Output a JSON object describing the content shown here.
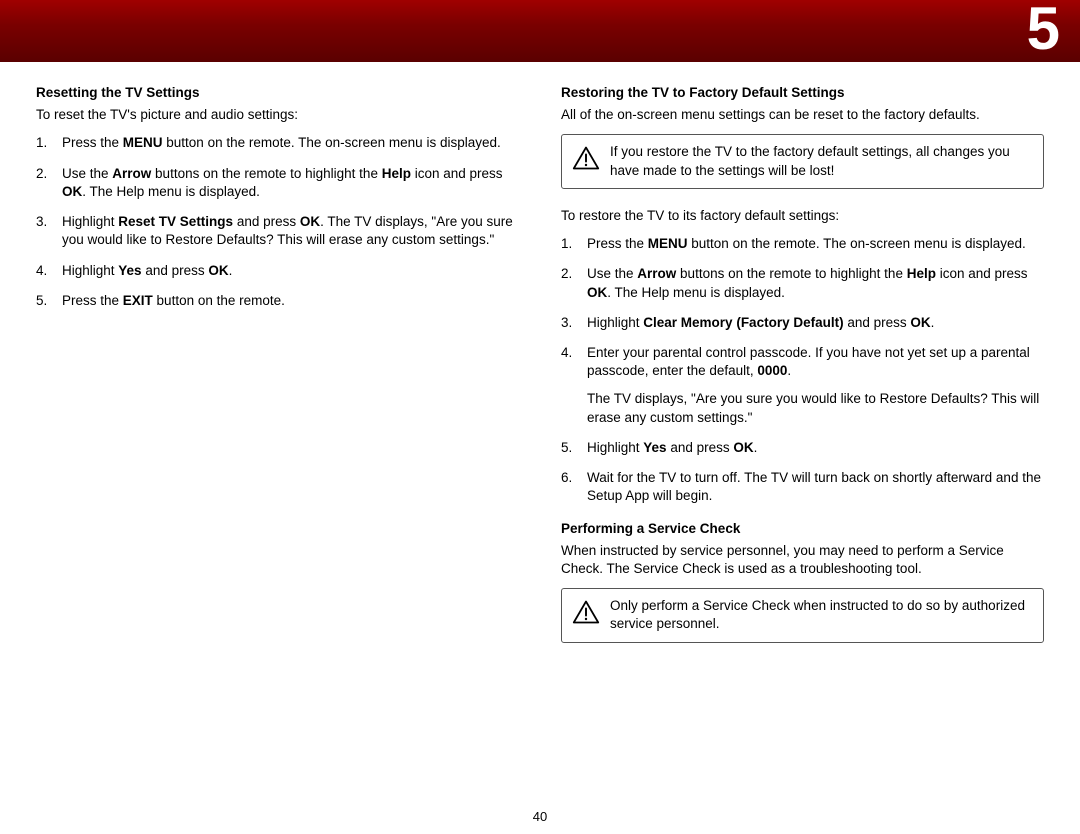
{
  "chapter": "5",
  "pageNumber": "40",
  "left": {
    "heading": "Resetting the TV Settings",
    "intro": "To reset the TV's picture and audio settings:",
    "steps": [
      {
        "pre": "Press the ",
        "b1": "MENU",
        "post1": " button on the remote. The on-screen menu is displayed."
      },
      {
        "pre": "Use the ",
        "b1": "Arrow",
        "mid1": " buttons on the remote to highlight the ",
        "b2": "Help",
        "mid2": " icon and press ",
        "b3": "OK",
        "post": ". The Help menu is displayed."
      },
      {
        "pre": "Highlight ",
        "b1": "Reset TV Settings",
        "mid1": " and press ",
        "b2": "OK",
        "post": ". The TV displays, \"Are you sure you would like to Restore Defaults? This will erase any custom settings.\""
      },
      {
        "pre": "Highlight ",
        "b1": "Yes",
        "mid1": " and press ",
        "b2": "OK",
        "post": "."
      },
      {
        "pre": "Press the ",
        "b1": "EXIT",
        "post1": " button on the remote."
      }
    ]
  },
  "right": {
    "heading1": "Restoring the TV to Factory Default Settings",
    "intro1": "All of the on-screen menu settings can be reset to the factory defaults.",
    "warning1": "If you restore the TV to the factory default settings, all changes you have made to the settings will be lost!",
    "intro2": "To restore the TV to its factory default settings:",
    "steps": [
      {
        "pre": "Press the ",
        "b1": "MENU",
        "post1": " button on the remote. The on-screen menu is displayed."
      },
      {
        "pre": "Use the ",
        "b1": "Arrow",
        "mid1": " buttons on the remote to highlight the ",
        "b2": "Help",
        "mid2": " icon and press ",
        "b3": "OK",
        "post": ". The Help menu is displayed."
      },
      {
        "pre": "Highlight ",
        "b1": "Clear Memory (Factory Default)",
        "mid1": " and press ",
        "b2": "OK",
        "post": "."
      },
      {
        "pre": "Enter your parental control passcode. If you have not yet set up a parental passcode, enter the default, ",
        "b1": "0000",
        "post1": ".",
        "sub": "The TV displays, \"Are you sure you would like to Restore Defaults? This will erase any custom settings.\""
      },
      {
        "pre": "Highlight ",
        "b1": "Yes",
        "mid1": " and press ",
        "b2": "OK",
        "post": "."
      },
      {
        "plain": "Wait for the TV to turn off. The TV will turn back on shortly afterward and the Setup App will begin."
      }
    ],
    "heading2": "Performing a Service Check",
    "intro3": "When instructed by service personnel, you may need to perform a Service Check. The Service Check is used as a troubleshooting tool.",
    "warning2": "Only perform a Service Check when instructed to do so by authorized service personnel."
  }
}
